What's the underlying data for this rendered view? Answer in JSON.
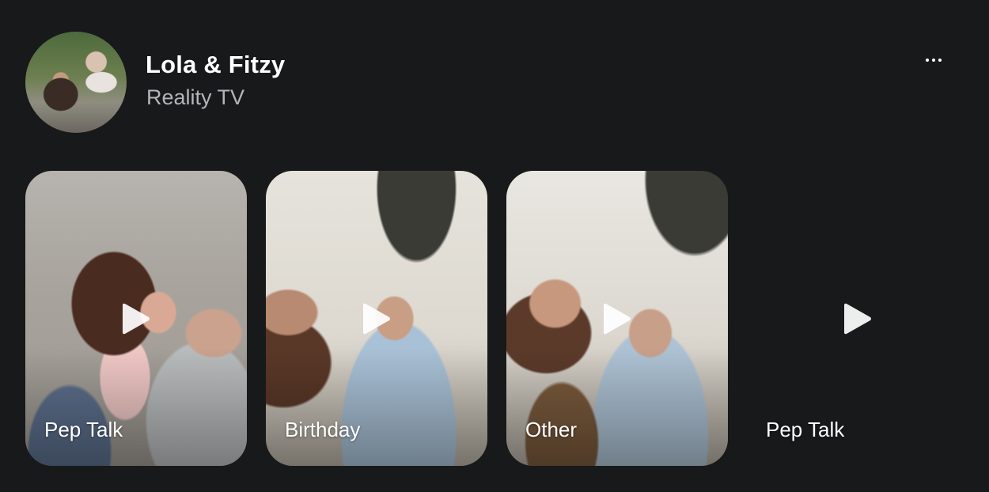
{
  "header": {
    "title": "Lola & Fitzy",
    "subtitle": "Reality TV",
    "more_label": "More options"
  },
  "cards": [
    {
      "label": "Pep Talk"
    },
    {
      "label": "Birthday"
    },
    {
      "label": "Other"
    },
    {
      "label": "Pep Talk"
    }
  ],
  "icons": {
    "more": "more-horizontal-icon",
    "play": "play-icon"
  }
}
